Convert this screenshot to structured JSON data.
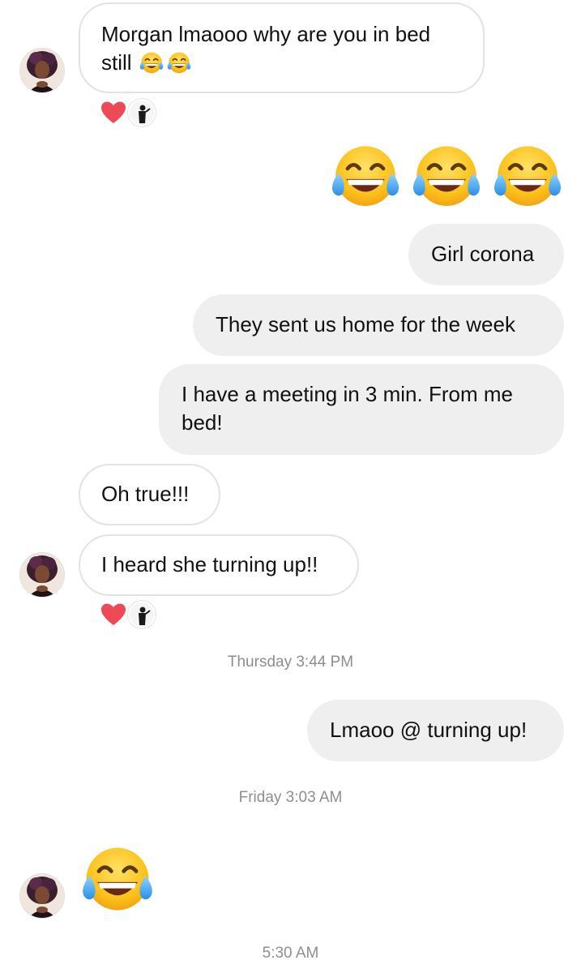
{
  "thread": {
    "messages": [
      {
        "sender": "them",
        "text": "Morgan lmaooo why are you in bed still"
      },
      {
        "sender": "me",
        "emoji": "face-with-tears-of-joy",
        "count": 3
      },
      {
        "sender": "me",
        "text": "Girl corona"
      },
      {
        "sender": "me",
        "text": "They sent us home for the week"
      },
      {
        "sender": "me",
        "text": "I have a meeting in 3 min. From me bed!"
      },
      {
        "sender": "them",
        "text": "Oh true!!!"
      },
      {
        "sender": "them",
        "text": "I heard she turning up!!"
      },
      {
        "sender": "me",
        "text": "Lmaoo @ turning up!"
      },
      {
        "sender": "them",
        "emoji": "face-with-tears-of-joy",
        "count": 1
      }
    ],
    "msg1_line1": "Morgan lmaooo why are you in bed",
    "msg1_line2": "still",
    "msg3": "Girl corona",
    "msg4": "They sent us home for the week",
    "msg5_line1": "I have a meeting in 3 min. From me",
    "msg5_line2": "bed!",
    "msg6": "Oh true!!!",
    "msg7": "I heard she turning up!!",
    "msg8": "Lmaoo @ turning up!"
  },
  "timestamps": {
    "first": "Thursday 3:44 PM",
    "second": "Friday 3:03 AM",
    "third": "5:30 AM"
  },
  "colors": {
    "sent_bubble": "#efefef",
    "received_border": "#e3e3e3",
    "heart": "#ed4956",
    "timestamp": "#8e8e8e"
  },
  "icons": {
    "reaction": "heart-icon",
    "emoji": "face-with-tears-of-joy"
  }
}
